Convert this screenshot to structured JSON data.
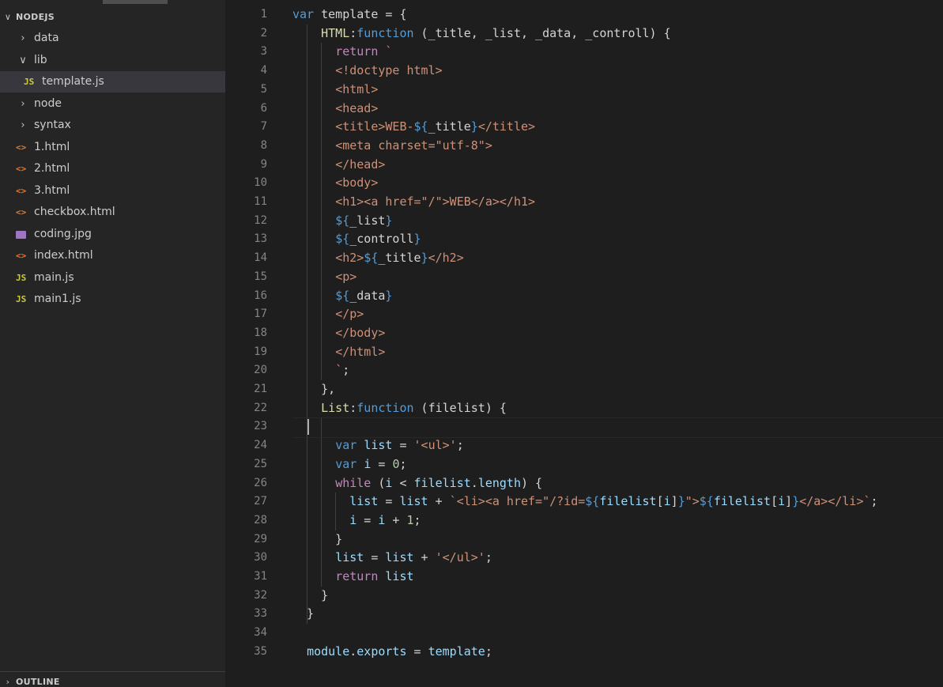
{
  "explorer": {
    "section_title": "NODEJS",
    "outline_title": "OUTLINE",
    "items": [
      {
        "label": "data",
        "type": "folder",
        "expanded": false,
        "depth": 0
      },
      {
        "label": "lib",
        "type": "folder",
        "expanded": true,
        "depth": 0
      },
      {
        "label": "template.js",
        "type": "js",
        "depth": 1,
        "selected": true
      },
      {
        "label": "node",
        "type": "folder",
        "expanded": false,
        "depth": 0
      },
      {
        "label": "syntax",
        "type": "folder",
        "expanded": false,
        "depth": 0
      },
      {
        "label": "1.html",
        "type": "html",
        "depth": 0
      },
      {
        "label": "2.html",
        "type": "html",
        "depth": 0
      },
      {
        "label": "3.html",
        "type": "html",
        "depth": 0
      },
      {
        "label": "checkbox.html",
        "type": "html",
        "depth": 0
      },
      {
        "label": "coding.jpg",
        "type": "image",
        "depth": 0
      },
      {
        "label": "index.html",
        "type": "html",
        "depth": 0
      },
      {
        "label": "main.js",
        "type": "js",
        "depth": 0
      },
      {
        "label": "main1.js",
        "type": "js",
        "depth": 0
      }
    ]
  },
  "icons": {
    "js": "JS",
    "html": "<>",
    "folder_collapsed": "chevron-right-icon",
    "folder_expanded": "chevron-down-icon"
  },
  "editor": {
    "file": "template.js",
    "cursor_line": 23,
    "lines": [
      [
        [
          "kw",
          "var"
        ],
        [
          "plain",
          " template = {"
        ]
      ],
      [
        [
          "plain",
          "    "
        ],
        [
          "prop",
          "HTML"
        ],
        [
          "plain",
          ":"
        ],
        [
          "kw",
          "function"
        ],
        [
          "plain",
          " (_title, _list, _data, _controll) {"
        ]
      ],
      [
        [
          "plain",
          "      "
        ],
        [
          "kw2",
          "return"
        ],
        [
          "plain",
          " "
        ],
        [
          "str",
          "`"
        ]
      ],
      [
        [
          "plain",
          "      "
        ],
        [
          "str",
          "<!doctype html>"
        ]
      ],
      [
        [
          "plain",
          "      "
        ],
        [
          "str",
          "<html>"
        ]
      ],
      [
        [
          "plain",
          "      "
        ],
        [
          "str",
          "<head>"
        ]
      ],
      [
        [
          "plain",
          "      "
        ],
        [
          "str",
          "<title>WEB-"
        ],
        [
          "tpl",
          "${"
        ],
        [
          "plain",
          "_title"
        ],
        [
          "tpl",
          "}"
        ],
        [
          "str",
          "</title>"
        ]
      ],
      [
        [
          "plain",
          "      "
        ],
        [
          "str",
          "<meta charset=\"utf-8\">"
        ]
      ],
      [
        [
          "plain",
          "      "
        ],
        [
          "str",
          "</head>"
        ]
      ],
      [
        [
          "plain",
          "      "
        ],
        [
          "str",
          "<body>"
        ]
      ],
      [
        [
          "plain",
          "      "
        ],
        [
          "str",
          "<h1><a href=\"/\">WEB</a></h1>"
        ]
      ],
      [
        [
          "plain",
          "      "
        ],
        [
          "tpl",
          "${"
        ],
        [
          "plain",
          "_list"
        ],
        [
          "tpl",
          "}"
        ]
      ],
      [
        [
          "plain",
          "      "
        ],
        [
          "tpl",
          "${"
        ],
        [
          "plain",
          "_controll"
        ],
        [
          "tpl",
          "}"
        ]
      ],
      [
        [
          "plain",
          "      "
        ],
        [
          "str",
          "<h2>"
        ],
        [
          "tpl",
          "${"
        ],
        [
          "plain",
          "_title"
        ],
        [
          "tpl",
          "}"
        ],
        [
          "str",
          "</h2>"
        ]
      ],
      [
        [
          "plain",
          "      "
        ],
        [
          "str",
          "<p>"
        ]
      ],
      [
        [
          "plain",
          "      "
        ],
        [
          "tpl",
          "${"
        ],
        [
          "plain",
          "_data"
        ],
        [
          "tpl",
          "}"
        ]
      ],
      [
        [
          "plain",
          "      "
        ],
        [
          "str",
          "</p>"
        ]
      ],
      [
        [
          "plain",
          "      "
        ],
        [
          "str",
          "</body>"
        ]
      ],
      [
        [
          "plain",
          "      "
        ],
        [
          "str",
          "</html>"
        ]
      ],
      [
        [
          "plain",
          "      "
        ],
        [
          "str",
          "`"
        ],
        [
          "plain",
          ";"
        ]
      ],
      [
        [
          "plain",
          "    },"
        ]
      ],
      [
        [
          "plain",
          "    "
        ],
        [
          "prop",
          "List"
        ],
        [
          "plain",
          ":"
        ],
        [
          "kw",
          "function"
        ],
        [
          "plain",
          " (filelist) {"
        ]
      ],
      [
        [
          "plain",
          "  "
        ]
      ],
      [
        [
          "plain",
          "      "
        ],
        [
          "kw",
          "var"
        ],
        [
          "plain",
          " "
        ],
        [
          "var",
          "list"
        ],
        [
          "plain",
          " = "
        ],
        [
          "str",
          "'<ul>'"
        ],
        [
          "plain",
          ";"
        ]
      ],
      [
        [
          "plain",
          "      "
        ],
        [
          "kw",
          "var"
        ],
        [
          "plain",
          " "
        ],
        [
          "var",
          "i"
        ],
        [
          "plain",
          " = "
        ],
        [
          "num",
          "0"
        ],
        [
          "plain",
          ";"
        ]
      ],
      [
        [
          "plain",
          "      "
        ],
        [
          "kw2",
          "while"
        ],
        [
          "plain",
          " ("
        ],
        [
          "var",
          "i"
        ],
        [
          "plain",
          " < "
        ],
        [
          "var",
          "filelist"
        ],
        [
          "plain",
          "."
        ],
        [
          "var",
          "length"
        ],
        [
          "plain",
          ") {"
        ]
      ],
      [
        [
          "plain",
          "        "
        ],
        [
          "var",
          "list"
        ],
        [
          "plain",
          " = "
        ],
        [
          "var",
          "list"
        ],
        [
          "plain",
          " + "
        ],
        [
          "str",
          "`<li><a href=\"/?id="
        ],
        [
          "tpl",
          "${"
        ],
        [
          "var",
          "filelist"
        ],
        [
          "plain",
          "["
        ],
        [
          "var",
          "i"
        ],
        [
          "plain",
          "]"
        ],
        [
          "tpl",
          "}"
        ],
        [
          "str",
          "\">"
        ],
        [
          "tpl",
          "${"
        ],
        [
          "var",
          "filelist"
        ],
        [
          "plain",
          "["
        ],
        [
          "var",
          "i"
        ],
        [
          "plain",
          "]"
        ],
        [
          "tpl",
          "}"
        ],
        [
          "str",
          "</a></li>`"
        ],
        [
          "plain",
          ";"
        ]
      ],
      [
        [
          "plain",
          "        "
        ],
        [
          "var",
          "i"
        ],
        [
          "plain",
          " = "
        ],
        [
          "var",
          "i"
        ],
        [
          "plain",
          " + "
        ],
        [
          "num",
          "1"
        ],
        [
          "plain",
          ";"
        ]
      ],
      [
        [
          "plain",
          "      }"
        ]
      ],
      [
        [
          "plain",
          "      "
        ],
        [
          "var",
          "list"
        ],
        [
          "plain",
          " = "
        ],
        [
          "var",
          "list"
        ],
        [
          "plain",
          " + "
        ],
        [
          "str",
          "'</ul>'"
        ],
        [
          "plain",
          ";"
        ]
      ],
      [
        [
          "plain",
          "      "
        ],
        [
          "kw2",
          "return"
        ],
        [
          "plain",
          " "
        ],
        [
          "var",
          "list"
        ]
      ],
      [
        [
          "plain",
          "    }"
        ]
      ],
      [
        [
          "plain",
          "  }"
        ]
      ],
      [
        [
          "plain",
          ""
        ]
      ],
      [
        [
          "plain",
          "  "
        ],
        [
          "var",
          "module"
        ],
        [
          "plain",
          "."
        ],
        [
          "var",
          "exports"
        ],
        [
          "plain",
          " = "
        ],
        [
          "var",
          "template"
        ],
        [
          "plain",
          ";"
        ]
      ]
    ]
  }
}
